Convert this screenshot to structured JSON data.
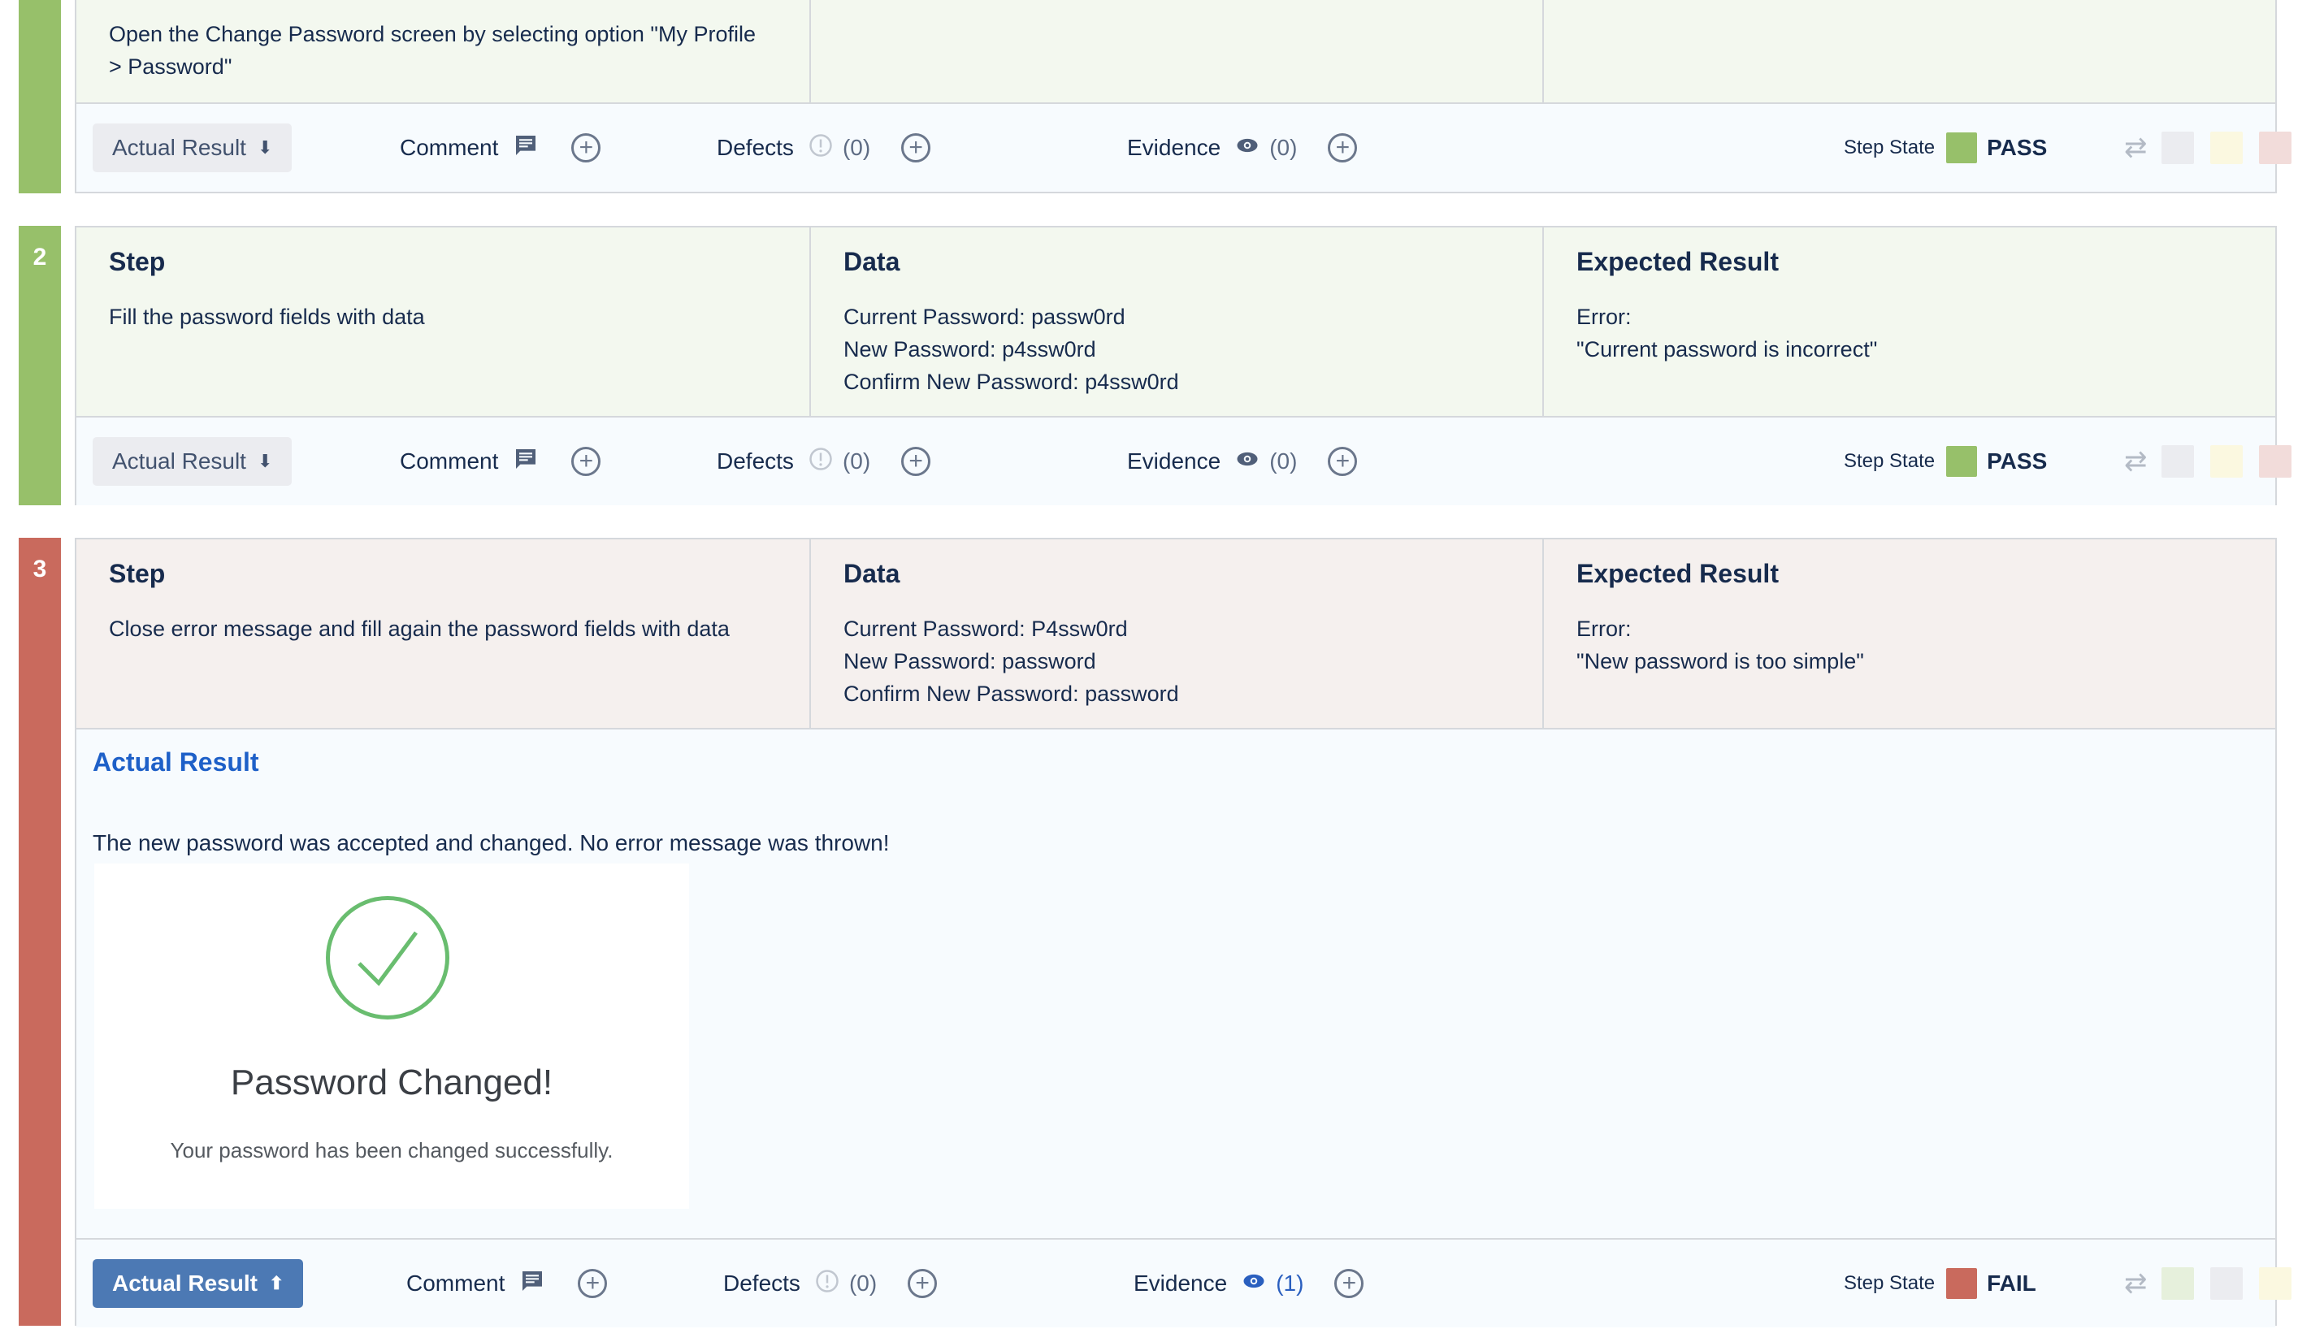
{
  "colors": {
    "pass": "#97c06a",
    "fail": "#c96a5d",
    "pass_bg": "#f3f8ef",
    "fail_bg": "#f5f0ee"
  },
  "labels": {
    "step": "Step",
    "data": "Data",
    "expected": "Expected Result",
    "actual_result": "Actual Result",
    "comment": "Comment",
    "defects": "Defects",
    "evidence": "Evidence",
    "step_state": "Step State"
  },
  "step1": {
    "step_lines": [
      "Open the Change Password screen by selecting option \"My Profile",
      "> Password\""
    ],
    "defects_count": "(0)",
    "evidence_count": "(0)",
    "state": "PASS"
  },
  "step2": {
    "number": "2",
    "step_lines": [
      "Fill the password fields with data"
    ],
    "data_lines": [
      "Current Password: passw0rd",
      "New Password: p4ssw0rd",
      "Confirm New Password: p4ssw0rd"
    ],
    "expected_lines": [
      "Error:",
      "\"Current password is incorrect\""
    ],
    "defects_count": "(0)",
    "evidence_count": "(0)",
    "state": "PASS"
  },
  "step3": {
    "number": "3",
    "step_lines": [
      "Close error message and fill again the password fields with data"
    ],
    "data_lines": [
      "Current Password: P4ssw0rd",
      "New Password: password",
      "Confirm New Password: password"
    ],
    "expected_lines": [
      "Error:",
      "\"New password is too simple\""
    ],
    "actual_text": "The new password was accepted and changed. No error message was thrown!",
    "evidence_title": "Password Changed!",
    "evidence_subtitle": "Your password has been changed successfully.",
    "defects_count": "(0)",
    "evidence_count": "(1)",
    "state": "FAIL"
  }
}
